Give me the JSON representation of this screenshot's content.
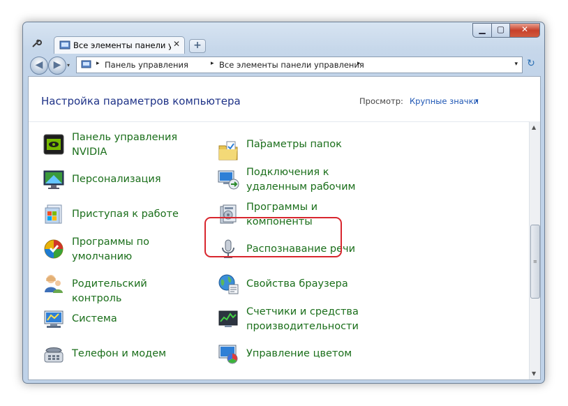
{
  "window": {
    "tab_label": "Все элементы панели упр",
    "tab_close": "✕",
    "new_tab": "+",
    "btn_min": "▁",
    "btn_max": "▢",
    "btn_close": "✕"
  },
  "nav": {
    "back": "◀",
    "forward": "▶",
    "history": "▾",
    "breadcrumbs": [
      "Панель управления",
      "Все элементы панели управления"
    ],
    "separator": "▸",
    "dropdown": "▾",
    "refresh": "↻"
  },
  "content": {
    "title": "Настройка параметров компьютера",
    "view_label": "Просмотр:",
    "view_value": "Крупные значки",
    "view_arrow": "▾",
    "partial_item": "⌄",
    "left_column": [
      {
        "label": "Панель управления NVIDIA",
        "icon": "nvidia-icon"
      },
      {
        "label": "Персонализация",
        "icon": "personalization-icon"
      },
      {
        "label": "Приступая к работе",
        "icon": "getting-started-icon"
      },
      {
        "label": "Программы по умолчанию",
        "icon": "default-programs-icon"
      },
      {
        "label": "Родительский контроль",
        "icon": "parental-control-icon"
      },
      {
        "label": "Система",
        "icon": "system-icon"
      },
      {
        "label": "Телефон и модем",
        "icon": "phone-modem-icon"
      }
    ],
    "right_column": [
      {
        "label": "Параметры папок",
        "icon": "folder-options-icon"
      },
      {
        "label": "Подключения к удаленным рабочим",
        "icon": "remote-connection-icon"
      },
      {
        "label": "Программы и компоненты",
        "icon": "programs-features-icon"
      },
      {
        "label": "Распознавание речи",
        "icon": "speech-recognition-icon"
      },
      {
        "label": "Свойства браузера",
        "icon": "browser-properties-icon"
      },
      {
        "label": "Счетчики и средства производительности",
        "icon": "performance-icon"
      },
      {
        "label": "Управление цветом",
        "icon": "color-management-icon"
      }
    ]
  },
  "scrollbar": {
    "up": "▲",
    "down": "▼",
    "grip": "≡"
  },
  "colors": {
    "link_green": "#1a6e1a",
    "title_blue": "#1e3287",
    "highlight_red": "#d8262e"
  }
}
